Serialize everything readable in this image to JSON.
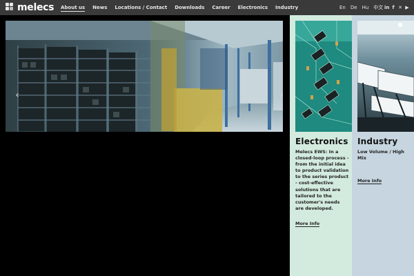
{
  "header": {
    "logo_text": "melecs",
    "nav": [
      {
        "label": "About us",
        "active": true
      },
      {
        "label": "News"
      },
      {
        "label": "Locations / Contact"
      },
      {
        "label": "Downloads"
      },
      {
        "label": "Career"
      },
      {
        "label": "Electronics"
      },
      {
        "label": "Industry"
      }
    ],
    "languages": [
      "En",
      "De",
      "Hu",
      "中文"
    ],
    "social": [
      {
        "icon": "linkedin-icon",
        "glyph": "in"
      },
      {
        "icon": "facebook-icon",
        "glyph": "f"
      },
      {
        "icon": "xing-icon",
        "glyph": "✕"
      },
      {
        "icon": "youtube-icon",
        "glyph": "▶"
      }
    ]
  },
  "hero": {
    "image": "warehouse-forklift-photo",
    "prev_icon": "chevron-left-icon",
    "next_icon": "chevron-right-icon",
    "prev_glyph": "‹",
    "next_glyph": "›"
  },
  "teasers": [
    {
      "title": "Electronics",
      "text": "Melecs EWS: In a closed-loop process - from the initial idea to product validation to the series product - cost-effective solutions that are tailored to the customer's needs are developed.",
      "link": "More Info",
      "image": "circuit-board-photo",
      "bg": "#d3ebde"
    },
    {
      "title": "Industry",
      "text": "Low Volume / High Mix",
      "link": "More Info",
      "image": "production-line-photo",
      "bg": "#c6d5df"
    }
  ],
  "colors": {
    "topbar": "#3a3a3a",
    "page_bg": "#000000",
    "nav_text": "#e6e6e6"
  }
}
